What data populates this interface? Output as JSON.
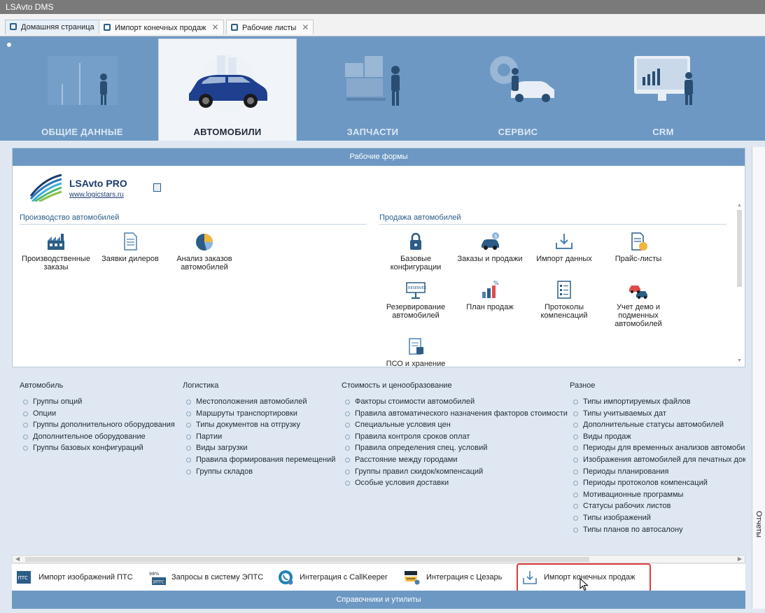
{
  "app": {
    "title": "LSAvto DMS"
  },
  "tabs": [
    {
      "label": "Домашняя страница"
    },
    {
      "label": "Импорт конечных продаж"
    },
    {
      "label": "Рабочие листы"
    }
  ],
  "categories": [
    {
      "label": "ОБЩИЕ ДАННЫЕ"
    },
    {
      "label": "АВТОМОБИЛИ"
    },
    {
      "label": "ЗАПЧАСТИ"
    },
    {
      "label": "СЕРВИС"
    },
    {
      "label": "CRM"
    }
  ],
  "side_panel": {
    "label": "Отчеты"
  },
  "work_forms": {
    "header": "Рабочие формы",
    "logo": {
      "name": "LSAvto PRO",
      "link": "www.logicstars.ru"
    },
    "production": {
      "title": "Производство автомобилей",
      "items": [
        {
          "label": "Производственные заказы",
          "icon": "factory-icon"
        },
        {
          "label": "Заявки дилеров",
          "icon": "document-icon"
        },
        {
          "label": "Анализ заказов автомобилей",
          "icon": "pie-chart-icon"
        }
      ]
    },
    "sales": {
      "title": "Продажа автомобилей",
      "items": [
        {
          "label": "Базовые конфигурации",
          "icon": "lock-icon"
        },
        {
          "label": "Заказы и продажи",
          "icon": "car-order-icon"
        },
        {
          "label": "Импорт данных",
          "icon": "download-icon"
        },
        {
          "label": "Прайс-листы",
          "icon": "price-list-icon"
        },
        {
          "label": "Резервирование автомобилей",
          "icon": "reserved-sign-icon"
        },
        {
          "label": "План продаж",
          "icon": "sales-plan-icon"
        },
        {
          "label": "Протоколы компенсаций",
          "icon": "checklist-icon"
        },
        {
          "label": "Учет демо и подменных автомобилей",
          "icon": "demo-cars-icon"
        },
        {
          "label": "ПСО и хранение",
          "icon": "storage-icon"
        }
      ]
    }
  },
  "reference_lists": [
    {
      "title": "Автомобиль",
      "links": [
        "Группы опций",
        "Опции",
        "Группы дополнительного оборудования",
        "Дополнительное оборудование",
        "Группы базовых конфигураций"
      ]
    },
    {
      "title": "Логистика",
      "links": [
        "Местоположения автомобилей",
        "Маршруты транспортировки",
        "Типы документов на отгрузку",
        "Партии",
        "Виды загрузки",
        "Правила формирования перемещений",
        "Группы складов"
      ]
    },
    {
      "title": "Стоимость и ценообразование",
      "links": [
        "Факторы стоимости автомобилей",
        "Правила автоматического назначения факторов стоимости",
        "Специальные условия цен",
        "Правила контроля сроков оплат",
        "Правила определения спец. условий",
        "Расстояние между городами",
        "Группы правил скидок/компенсаций",
        "Особые условия доставки"
      ]
    },
    {
      "title": "Разное",
      "links": [
        "Типы импортируемых файлов",
        "Типы учитываемых дат",
        "Дополнительные статусы автомобилей",
        "Виды продаж",
        "Периоды для временных анализов автомобилей",
        "Изображения автомобилей для печатных докум",
        "Периоды планирования",
        "Периоды протоколов компенсаций",
        "Мотивационные программы",
        "Статусы рабочих листов",
        "Типы изображений",
        "Типы планов по автосалону"
      ]
    }
  ],
  "utilities": {
    "footer": "Справочники и утилиты",
    "items": [
      {
        "label": "Импорт изображений ПТС",
        "icon": "pts-icon",
        "badge": "ПТС"
      },
      {
        "label": "Запросы в систему ЭПТС",
        "icon": "epts-icon",
        "badge": "ЭПТС",
        "percent": "98%"
      },
      {
        "label": "Интеграция с CallKeeper",
        "icon": "callkeeper-icon"
      },
      {
        "label": "Интеграция с Цезарь",
        "icon": "cezar-icon"
      },
      {
        "label": "Импорт конечных продаж",
        "icon": "download-tray-icon"
      }
    ]
  },
  "colors": {
    "accent": "#6d98c3",
    "highlight": "#e03a3a",
    "link": "#2b5d86"
  }
}
